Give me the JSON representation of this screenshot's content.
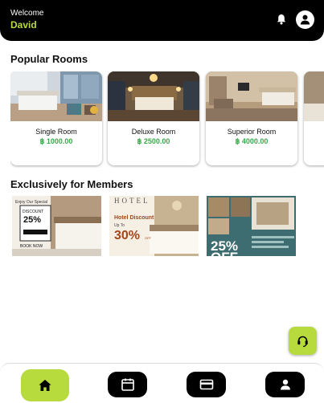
{
  "header": {
    "welcome": "Welcome",
    "user_name": "David"
  },
  "popular": {
    "title": "Popular Rooms",
    "rooms": [
      {
        "name": "Single Room",
        "price": "฿ 1000.00"
      },
      {
        "name": "Deluxe Room",
        "price": "฿ 2500.00"
      },
      {
        "name": "Superior Room",
        "price": "฿ 4000.00"
      }
    ]
  },
  "members": {
    "title": "Exclusively for Members",
    "promos": [
      {
        "headline": "Enjoy Our Special",
        "discount": "DISCOUNT",
        "percent": "25%",
        "cta": "BOOK NOW"
      },
      {
        "brand": "HOTEL",
        "headline": "Hotel Discount",
        "upto": "Up To",
        "percent": "30%",
        "off": "OFF"
      },
      {
        "percent": "25%",
        "off": "OFF"
      }
    ]
  },
  "colors": {
    "accent": "#b7db3c",
    "price": "#3aa94a",
    "header_bg": "#000000"
  },
  "icons": {
    "notification": "bell-icon",
    "profile": "user-icon",
    "fab": "support-bag-icon",
    "nav": [
      "home-icon",
      "calendar-icon",
      "card-icon",
      "profile-icon"
    ]
  }
}
